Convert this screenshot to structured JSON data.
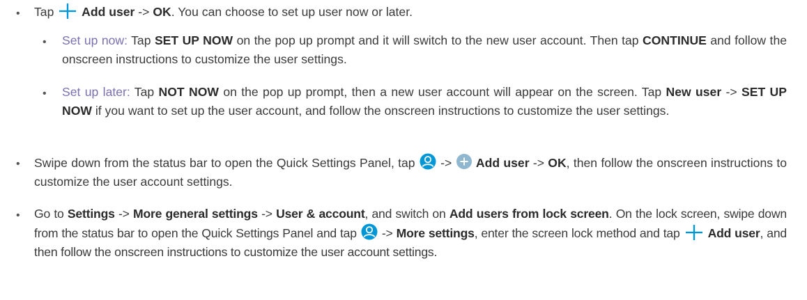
{
  "items": [
    {
      "l1": "Tap ",
      "add_user": "Add user",
      "arrow": " -> ",
      "ok": "OK",
      "rest": ". You can choose to set up user now or later."
    },
    {
      "label": "Set up now:",
      "t1": " Tap ",
      "b1": "SET UP NOW",
      "t2": " on the pop up prompt and it will switch to the new user account. Then tap ",
      "b2": "CONTINUE",
      "t3": " and follow the onscreen instructions to customize the user settings."
    },
    {
      "label": "Set up later:",
      "t1": " Tap ",
      "b1": "NOT NOW",
      "t2": " on the pop up prompt, then a new user account will appear on the screen. Tap ",
      "b2": "New user",
      "t3": " -> ",
      "b3": "SET UP NOW",
      "t4": " if you want to set up the user account, and follow the onscreen instructions to customize the user settings."
    },
    {
      "t1": "Swipe down from the status bar to open the Quick Settings Panel, tap ",
      "t2": " -> ",
      "b1": "Add user",
      "t3": " -> ",
      "b2": "OK",
      "t4": ", then follow the onscreen instructions to customize the user account settings."
    },
    {
      "t1": "Go to ",
      "b1": "Settings",
      "t2": " -> ",
      "b2": "More general settings",
      "t3": " -> ",
      "b3": "User & account",
      "t4": ", and switch on ",
      "b4": "Add users from lock screen",
      "t5": ". On the lock screen, swipe down from the status bar to open the Quick Settings Panel and tap ",
      "t6": " -> ",
      "b5": "More settings",
      "t7": ", enter the screen lock method and tap ",
      "b6": "Add user",
      "t8": ", and then follow the onscreen instructions to customize the user account settings."
    }
  ],
  "bullet_char": "•",
  "colors": {
    "accent": "#0097d6",
    "sub_label": "#7b6fae",
    "text": "#3a3a3a",
    "circle_plus": "#8fb7cf"
  },
  "icons": [
    "plus-icon",
    "user-circle-icon",
    "plus-circle-icon"
  ]
}
